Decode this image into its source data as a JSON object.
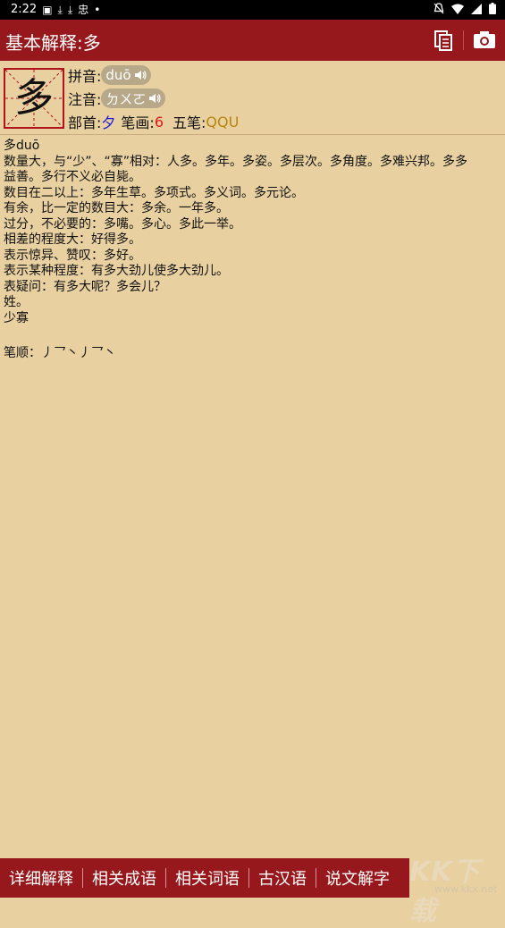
{
  "status_bar": {
    "time": "2:22",
    "left_icons": [
      "gallery-icon",
      "download-icon",
      "download-icon",
      "app-icon",
      "dot-icon"
    ],
    "right_icons": [
      "bell-off-icon",
      "wifi-icon",
      "signal-icon",
      "battery-icon"
    ]
  },
  "appbar": {
    "title": "基本解释:多",
    "actions": [
      "copy-icon",
      "camera-icon"
    ]
  },
  "header": {
    "character": "多",
    "pinyin_label": "拼音:",
    "pinyin": "duō",
    "zhuyin_label": "注音:",
    "zhuyin": "ㄉㄨㄛ",
    "radical_label": "部首:",
    "radical": "夕",
    "strokes_label": "笔画:",
    "strokes": "6",
    "wubi_label": "五笔:",
    "wubi": "QQU"
  },
  "content": {
    "lines": [
      "多duō",
      "数量大，与“少”、“寡”相对：人多。多年。多姿。多层次。多角度。多难兴邦。多多",
      "益善。多行不义必自毙。",
      "数目在二以上：多年生草。多项式。多义词。多元论。",
      "有余，比一定的数目大：多余。一年多。",
      "过分，不必要的：多嘴。多心。多此一举。",
      "相差的程度大：好得多。",
      "表示惊异、赞叹：多好。",
      "表示某种程度：有多大劲儿使多大劲儿。",
      "表疑问：有多大呢？多会儿？",
      "姓。",
      "少寡"
    ],
    "stroke_order": "笔顺：丿乛丶丿乛丶"
  },
  "bottom_tabs": [
    "详细解释",
    "相关成语",
    "相关词语",
    "古汉语",
    "说文解字"
  ],
  "watermark": {
    "brand": "KK下载",
    "url": "www.kkx.net"
  },
  "colors": {
    "primary": "#97181c",
    "background": "#e8d0a1",
    "pill": "#b8a88a"
  }
}
